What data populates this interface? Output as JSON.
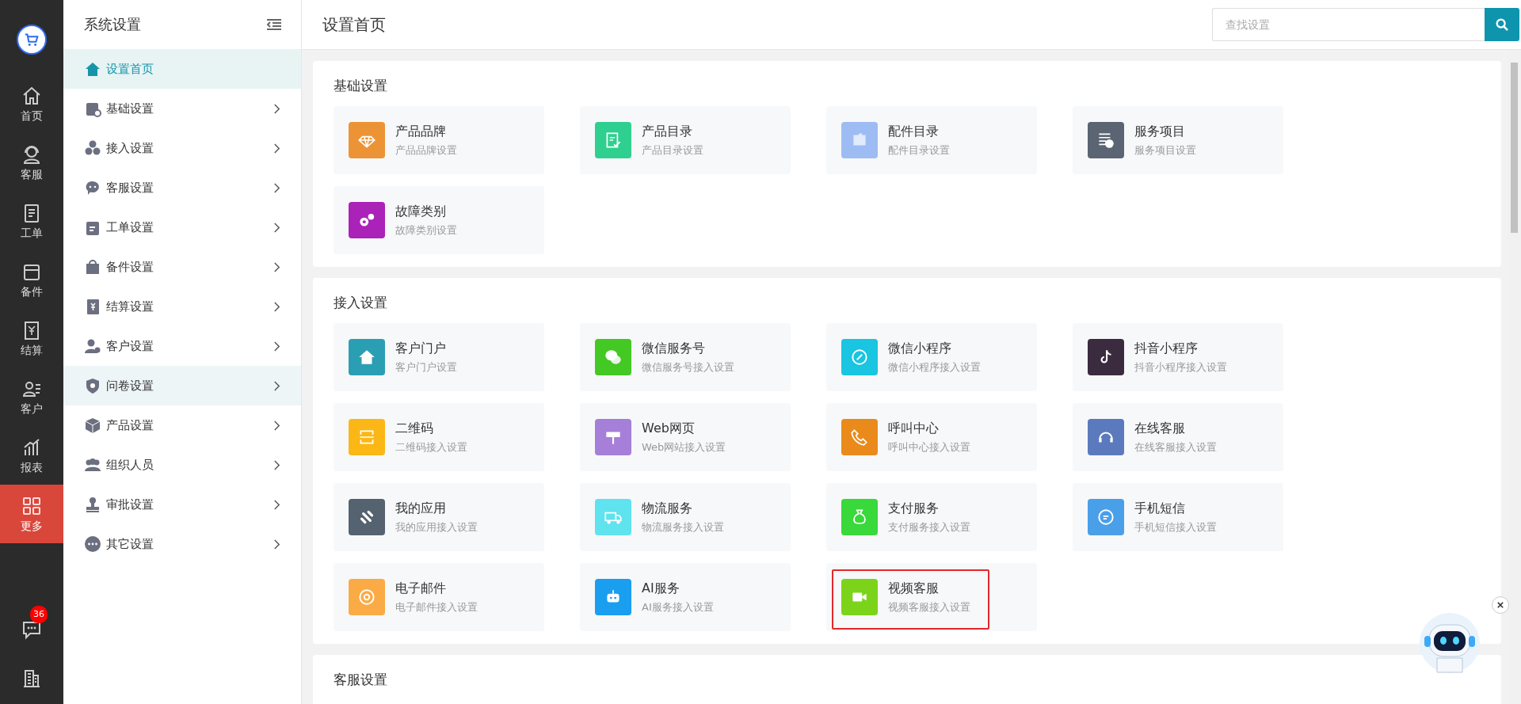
{
  "rail": {
    "items": [
      {
        "label": "首页",
        "selected": false
      },
      {
        "label": "客服",
        "selected": false
      },
      {
        "label": "工单",
        "selected": false
      },
      {
        "label": "备件",
        "selected": false
      },
      {
        "label": "结算",
        "selected": false
      },
      {
        "label": "客户",
        "selected": false
      },
      {
        "label": "报表",
        "selected": false
      },
      {
        "label": "更多",
        "selected": true
      }
    ],
    "chat_badge": "36"
  },
  "sidebar": {
    "title": "系统设置",
    "items": [
      {
        "label": "设置首页",
        "selected": true,
        "hovered": false,
        "has_arrow": false
      },
      {
        "label": "基础设置",
        "selected": false,
        "hovered": false,
        "has_arrow": true
      },
      {
        "label": "接入设置",
        "selected": false,
        "hovered": false,
        "has_arrow": true
      },
      {
        "label": "客服设置",
        "selected": false,
        "hovered": false,
        "has_arrow": true
      },
      {
        "label": "工单设置",
        "selected": false,
        "hovered": false,
        "has_arrow": true
      },
      {
        "label": "备件设置",
        "selected": false,
        "hovered": false,
        "has_arrow": true
      },
      {
        "label": "结算设置",
        "selected": false,
        "hovered": false,
        "has_arrow": true
      },
      {
        "label": "客户设置",
        "selected": false,
        "hovered": false,
        "has_arrow": true
      },
      {
        "label": "问卷设置",
        "selected": false,
        "hovered": true,
        "has_arrow": true
      },
      {
        "label": "产品设置",
        "selected": false,
        "hovered": false,
        "has_arrow": true
      },
      {
        "label": "组织人员",
        "selected": false,
        "hovered": false,
        "has_arrow": true
      },
      {
        "label": "审批设置",
        "selected": false,
        "hovered": false,
        "has_arrow": true
      },
      {
        "label": "其它设置",
        "selected": false,
        "hovered": false,
        "has_arrow": true
      }
    ]
  },
  "header": {
    "title": "设置首页",
    "search": {
      "placeholder": "查找设置"
    }
  },
  "sections": [
    {
      "title": "基础设置",
      "cards": [
        {
          "title": "产品品牌",
          "subtitle": "产品品牌设置",
          "color": "#ec9435",
          "highlighted": false
        },
        {
          "title": "产品目录",
          "subtitle": "产品目录设置",
          "color": "#2fcf8f",
          "highlighted": false
        },
        {
          "title": "配件目录",
          "subtitle": "配件目录设置",
          "color": "#9ebcf4",
          "highlighted": false
        },
        {
          "title": "服务项目",
          "subtitle": "服务项目设置",
          "color": "#5b6472",
          "highlighted": false
        },
        {
          "title": "故障类别",
          "subtitle": "故障类别设置",
          "color": "#aa22b7",
          "highlighted": false
        }
      ]
    },
    {
      "title": "接入设置",
      "cards": [
        {
          "title": "客户门户",
          "subtitle": "客户门户设置",
          "color": "#2a9fb3",
          "highlighted": false
        },
        {
          "title": "微信服务号",
          "subtitle": "微信服务号接入设置",
          "color": "#43c824",
          "highlighted": false
        },
        {
          "title": "微信小程序",
          "subtitle": "微信小程序接入设置",
          "color": "#19c5e0",
          "highlighted": false
        },
        {
          "title": "抖音小程序",
          "subtitle": "抖音小程序接入设置",
          "color": "#3b2b3f",
          "highlighted": false
        },
        {
          "title": "二维码",
          "subtitle": "二维码接入设置",
          "color": "#fbb716",
          "highlighted": false
        },
        {
          "title": "Web网页",
          "subtitle": "Web网站接入设置",
          "color": "#a67fd9",
          "highlighted": false
        },
        {
          "title": "呼叫中心",
          "subtitle": "呼叫中心接入设置",
          "color": "#e98a1b",
          "highlighted": false
        },
        {
          "title": "在线客服",
          "subtitle": "在线客服接入设置",
          "color": "#5b7abd",
          "highlighted": false
        },
        {
          "title": "我的应用",
          "subtitle": "我的应用接入设置",
          "color": "#556270",
          "highlighted": false
        },
        {
          "title": "物流服务",
          "subtitle": "物流服务接入设置",
          "color": "#5ee3ef",
          "highlighted": false
        },
        {
          "title": "支付服务",
          "subtitle": "支付服务接入设置",
          "color": "#39d83b",
          "highlighted": false
        },
        {
          "title": "手机短信",
          "subtitle": "手机短信接入设置",
          "color": "#4a9fe9",
          "highlighted": false
        },
        {
          "title": "电子邮件",
          "subtitle": "电子邮件接入设置",
          "color": "#fbab45",
          "highlighted": false
        },
        {
          "title": "AI服务",
          "subtitle": "AI服务接入设置",
          "color": "#199ef0",
          "highlighted": false
        },
        {
          "title": "视频客服",
          "subtitle": "视频客服接入设置",
          "color": "#7bd41a",
          "highlighted": true
        }
      ]
    },
    {
      "title": "客服设置"
    }
  ]
}
